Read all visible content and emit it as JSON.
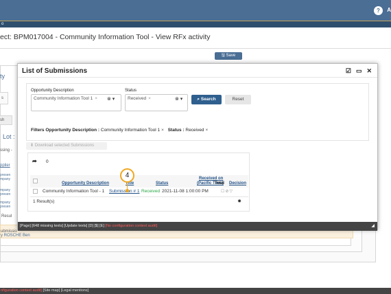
{
  "header": {
    "user_initial": "A"
  },
  "subbar": {
    "label": "o"
  },
  "page": {
    "title": "ect: BPM017004 - Community Information Tool - View RFx activity",
    "save_label": "Save"
  },
  "background": {
    "lines": [
      {
        "text": "ty",
        "style": "blue"
      },
      {
        "text": "s",
        "style": "normal"
      },
      {
        "text": "sh",
        "style": "normal"
      },
      {
        "text": "Lot :",
        "style": "blue"
      },
      {
        "text": "ssing -",
        "style": "normal"
      },
      {
        "text": "pplier",
        "style": "link"
      },
      {
        "text": "presen",
        "style": "blue"
      },
      {
        "text": "mpany",
        "style": "blue"
      },
      {
        "text": "mpany",
        "style": "blue"
      },
      {
        "text": "presen",
        "style": "blue"
      },
      {
        "text": "mpany",
        "style": "blue"
      },
      {
        "text": "presen",
        "style": "blue"
      },
      {
        "text": "Resul",
        "style": "normal"
      },
      {
        "text": "ubmissio",
        "style": "normal"
      },
      {
        "text": "y ROSCHE Ben",
        "style": "blue"
      }
    ]
  },
  "modal": {
    "title": "List of Submissions",
    "icons": [
      "checkbox-icon",
      "window-icon",
      "close-icon"
    ],
    "filters": {
      "opportunity_label": "Opportunity Description",
      "opportunity_tag": "Community Information Tool 1",
      "status_label": "Status",
      "status_tag": "Received",
      "search_label": "Search",
      "reset_label": "Reset",
      "applied_prefix": "Filters",
      "applied_opp_key": "Opportunity Description :",
      "applied_opp_val": "Community Information Tool 1",
      "applied_status_key": "Status :",
      "applied_status_val": "Received"
    },
    "download_label": "Download selected Submissions",
    "results": {
      "count": "0",
      "headers": {
        "opportunity": "Opportunity Description",
        "title": "Title",
        "status": "Status",
        "received_on": "Received on",
        "received_tz": "(Pacific Time)",
        "total": "Total",
        "decision": "Decision"
      },
      "row": {
        "opportunity": "Community Information Tool - 1",
        "title": "Submission # 1",
        "status": "Received",
        "received": "2021-11-08 1:00:00 PM"
      },
      "result_count": "1 Result(s)"
    },
    "callout_number": "4",
    "status_bar": {
      "normal": "[Page] [648 missing texts] [Update texts] [D] [$] [E]",
      "warning": "[No configuration context audit]"
    }
  },
  "footer": {
    "warning": "nfiguration context audit]",
    "links": "[Site map] [Legal mentions]"
  },
  "colors": {
    "topbar": "#4a6e94",
    "primary_button": "#2f5f8e",
    "status_received": "#2aa745",
    "callout": "#f0a820"
  }
}
